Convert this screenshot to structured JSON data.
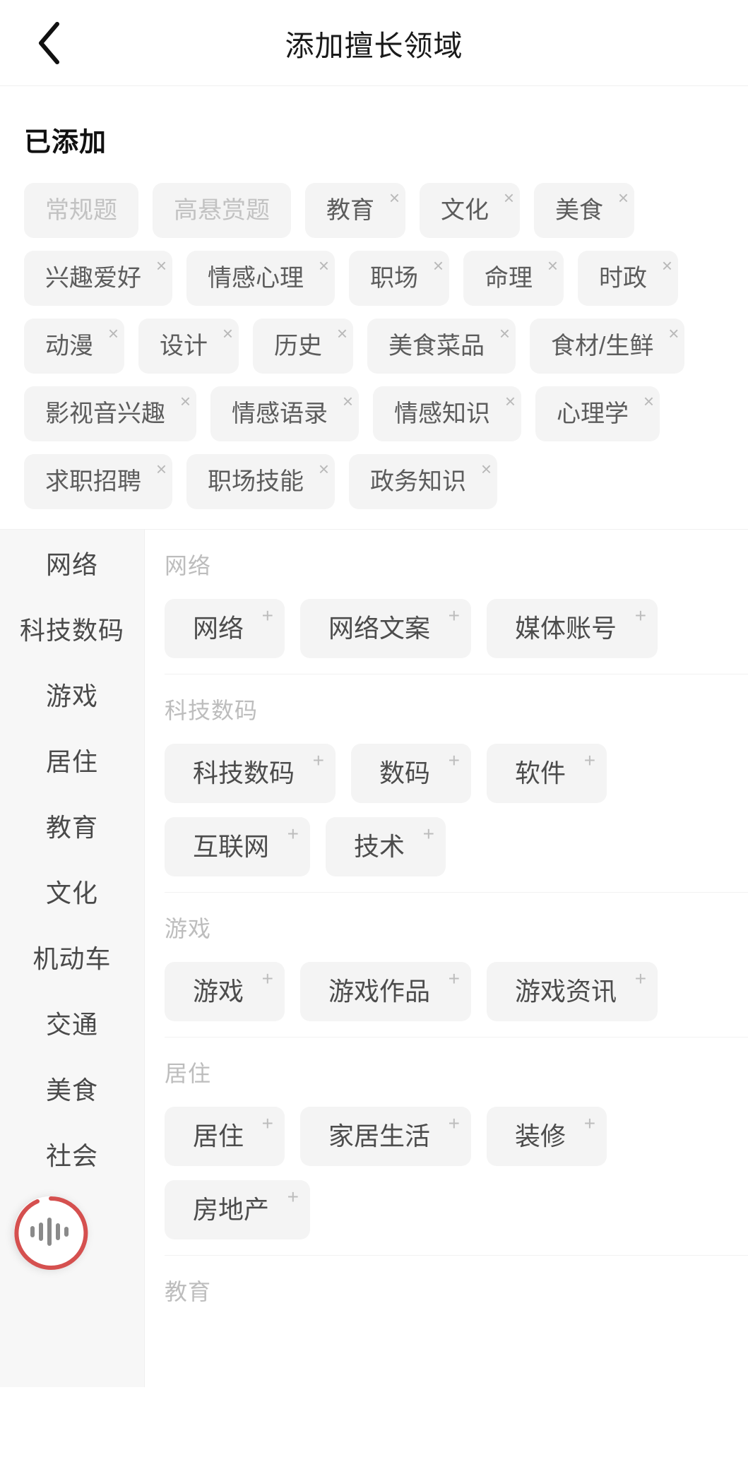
{
  "header": {
    "back_icon": "chevron-left-icon",
    "title": "添加擅长领域"
  },
  "added": {
    "title": "已添加",
    "remove_glyph": "×",
    "tags": [
      {
        "label": "常规题",
        "removable": false
      },
      {
        "label": "高悬赏题",
        "removable": false
      },
      {
        "label": "教育",
        "removable": true
      },
      {
        "label": "文化",
        "removable": true
      },
      {
        "label": "美食",
        "removable": true
      },
      {
        "label": "兴趣爱好",
        "removable": true
      },
      {
        "label": "情感心理",
        "removable": true
      },
      {
        "label": "职场",
        "removable": true
      },
      {
        "label": "命理",
        "removable": true
      },
      {
        "label": "时政",
        "removable": true
      },
      {
        "label": "动漫",
        "removable": true
      },
      {
        "label": "设计",
        "removable": true
      },
      {
        "label": "历史",
        "removable": true
      },
      {
        "label": "美食菜品",
        "removable": true
      },
      {
        "label": "食材/生鲜",
        "removable": true
      },
      {
        "label": "影视音兴趣",
        "removable": true
      },
      {
        "label": "情感语录",
        "removable": true
      },
      {
        "label": "情感知识",
        "removable": true
      },
      {
        "label": "心理学",
        "removable": true
      },
      {
        "label": "求职招聘",
        "removable": true
      },
      {
        "label": "职场技能",
        "removable": true
      },
      {
        "label": "政务知识",
        "removable": true
      }
    ]
  },
  "sidebar": {
    "items": [
      {
        "label": "网络"
      },
      {
        "label": "科技数码"
      },
      {
        "label": "游戏"
      },
      {
        "label": "居住"
      },
      {
        "label": "教育"
      },
      {
        "label": "文化"
      },
      {
        "label": "机动车"
      },
      {
        "label": "交通"
      },
      {
        "label": "美食"
      },
      {
        "label": "社会"
      }
    ]
  },
  "catalog": {
    "add_glyph": "+",
    "groups": [
      {
        "title": "网络",
        "items": [
          {
            "label": "网络"
          },
          {
            "label": "网络文案"
          },
          {
            "label": "媒体账号"
          }
        ]
      },
      {
        "title": "科技数码",
        "items": [
          {
            "label": "科技数码"
          },
          {
            "label": "数码"
          },
          {
            "label": "软件"
          },
          {
            "label": "互联网"
          },
          {
            "label": "技术"
          }
        ]
      },
      {
        "title": "游戏",
        "items": [
          {
            "label": "游戏"
          },
          {
            "label": "游戏作品"
          },
          {
            "label": "游戏资讯"
          }
        ]
      },
      {
        "title": "居住",
        "items": [
          {
            "label": "居住"
          },
          {
            "label": "家居生活"
          },
          {
            "label": "装修"
          },
          {
            "label": "房地产"
          }
        ]
      },
      {
        "title": "教育",
        "items": []
      }
    ]
  },
  "voice_fab": {
    "icon": "voice-waveform-icon",
    "ring_color": "#d5504f"
  }
}
